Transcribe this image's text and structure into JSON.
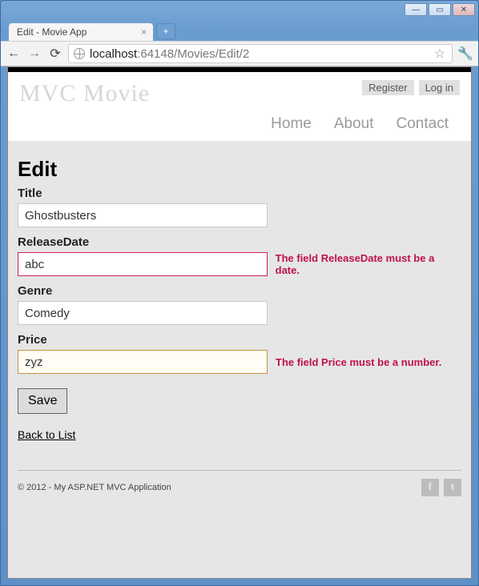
{
  "window": {
    "tab_title": "Edit - Movie App",
    "url_host": "localhost",
    "url_port": ":64148",
    "url_path": "/Movies/Edit/2"
  },
  "header": {
    "brand": "MVC Movie",
    "auth": {
      "register": "Register",
      "login": "Log in"
    },
    "nav": {
      "home": "Home",
      "about": "About",
      "contact": "Contact"
    }
  },
  "page": {
    "heading": "Edit",
    "fields": {
      "title": {
        "label": "Title",
        "value": "Ghostbusters"
      },
      "releaseDate": {
        "label": "ReleaseDate",
        "value": "abc",
        "error": "The field ReleaseDate must be a date."
      },
      "genre": {
        "label": "Genre",
        "value": "Comedy"
      },
      "price": {
        "label": "Price",
        "value": "zyz",
        "error": "The field Price must be a number."
      }
    },
    "save_label": "Save",
    "back_label": "Back to List"
  },
  "footer": {
    "copyright": "© 2012 - My ASP.NET MVC Application",
    "social": {
      "facebook": "f",
      "twitter": "t"
    }
  }
}
